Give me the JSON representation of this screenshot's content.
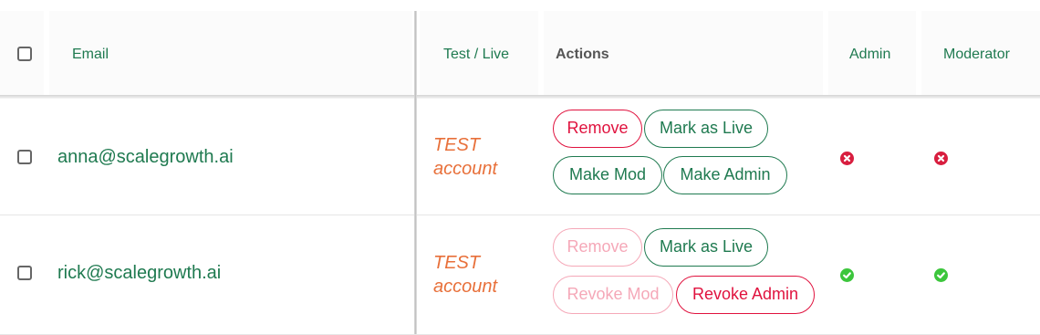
{
  "header": {
    "email": "Email",
    "test_live": "Test / Live",
    "actions": "Actions",
    "admin": "Admin",
    "moderator": "Moderator"
  },
  "rows": [
    {
      "email": "anna@scalegrowth.ai",
      "test_status_line1": "TEST",
      "test_status_line2": "account",
      "buttons": {
        "remove": "Remove",
        "mark_live": "Mark as Live",
        "mod": "Make Mod",
        "admin": "Make Admin"
      },
      "admin": "no",
      "moderator": "no"
    },
    {
      "email": "rick@scalegrowth.ai",
      "test_status_line1": "TEST",
      "test_status_line2": "account",
      "buttons": {
        "remove": "Remove",
        "mark_live": "Mark as Live",
        "mod": "Revoke Mod",
        "admin": "Revoke Admin"
      },
      "admin": "yes",
      "moderator": "yes"
    }
  ],
  "colors": {
    "primary": "#1f7a50",
    "danger": "#e0123e",
    "danger_faded": "#f5a8b8",
    "test_text": "#e8703a",
    "yes": "#3cc63c",
    "no": "#d81e3f"
  },
  "icons": {
    "yes": "check-circle-icon",
    "no": "x-circle-icon"
  }
}
